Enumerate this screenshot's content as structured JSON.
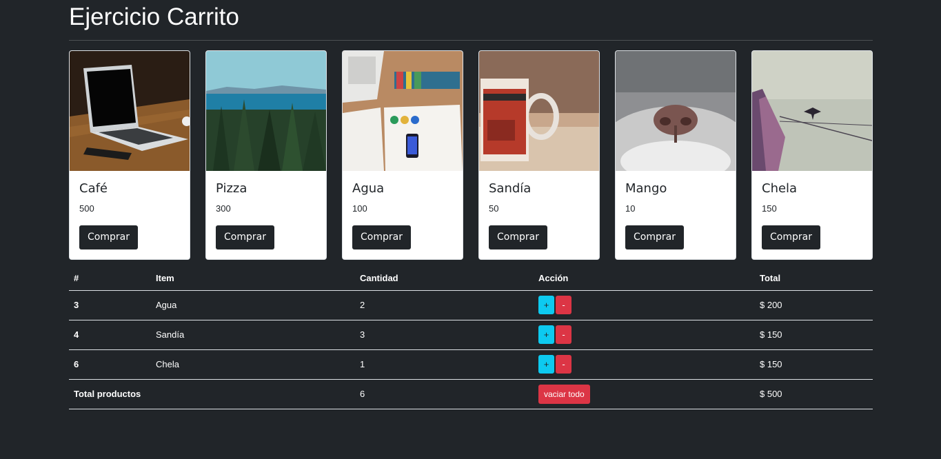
{
  "page": {
    "title": "Ejercicio Carrito"
  },
  "products": [
    {
      "name": "Café",
      "price": "500",
      "button": "Comprar",
      "image": "laptop-on-wooden-table"
    },
    {
      "name": "Pizza",
      "price": "300",
      "button": "Comprar",
      "image": "forest-and-lake"
    },
    {
      "name": "Agua",
      "price": "100",
      "button": "Comprar",
      "image": "desk-with-papers-and-phone"
    },
    {
      "name": "Sandía",
      "price": "50",
      "button": "Comprar",
      "image": "red-mug"
    },
    {
      "name": "Mango",
      "price": "10",
      "button": "Comprar",
      "image": "cat-nose-closeup"
    },
    {
      "name": "Chela",
      "price": "150",
      "button": "Comprar",
      "image": "pier-with-bird"
    }
  ],
  "cart": {
    "headers": {
      "id": "#",
      "item": "Item",
      "qty": "Cantidad",
      "action": "Acción",
      "total": "Total"
    },
    "rows": [
      {
        "id": "3",
        "item": "Agua",
        "qty": "2",
        "add": "+",
        "sub": "-",
        "total": "$ 200"
      },
      {
        "id": "4",
        "item": "Sandía",
        "qty": "3",
        "add": "+",
        "sub": "-",
        "total": "$ 150"
      },
      {
        "id": "6",
        "item": "Chela",
        "qty": "1",
        "add": "+",
        "sub": "-",
        "total": "$ 150"
      }
    ],
    "footer": {
      "label": "Total productos",
      "qty": "6",
      "clear": "vaciar todo",
      "total": "$ 500"
    }
  },
  "colors": {
    "background": "#212529",
    "info": "#0dcaf0",
    "danger": "#dc3545",
    "card": "#ffffff"
  }
}
